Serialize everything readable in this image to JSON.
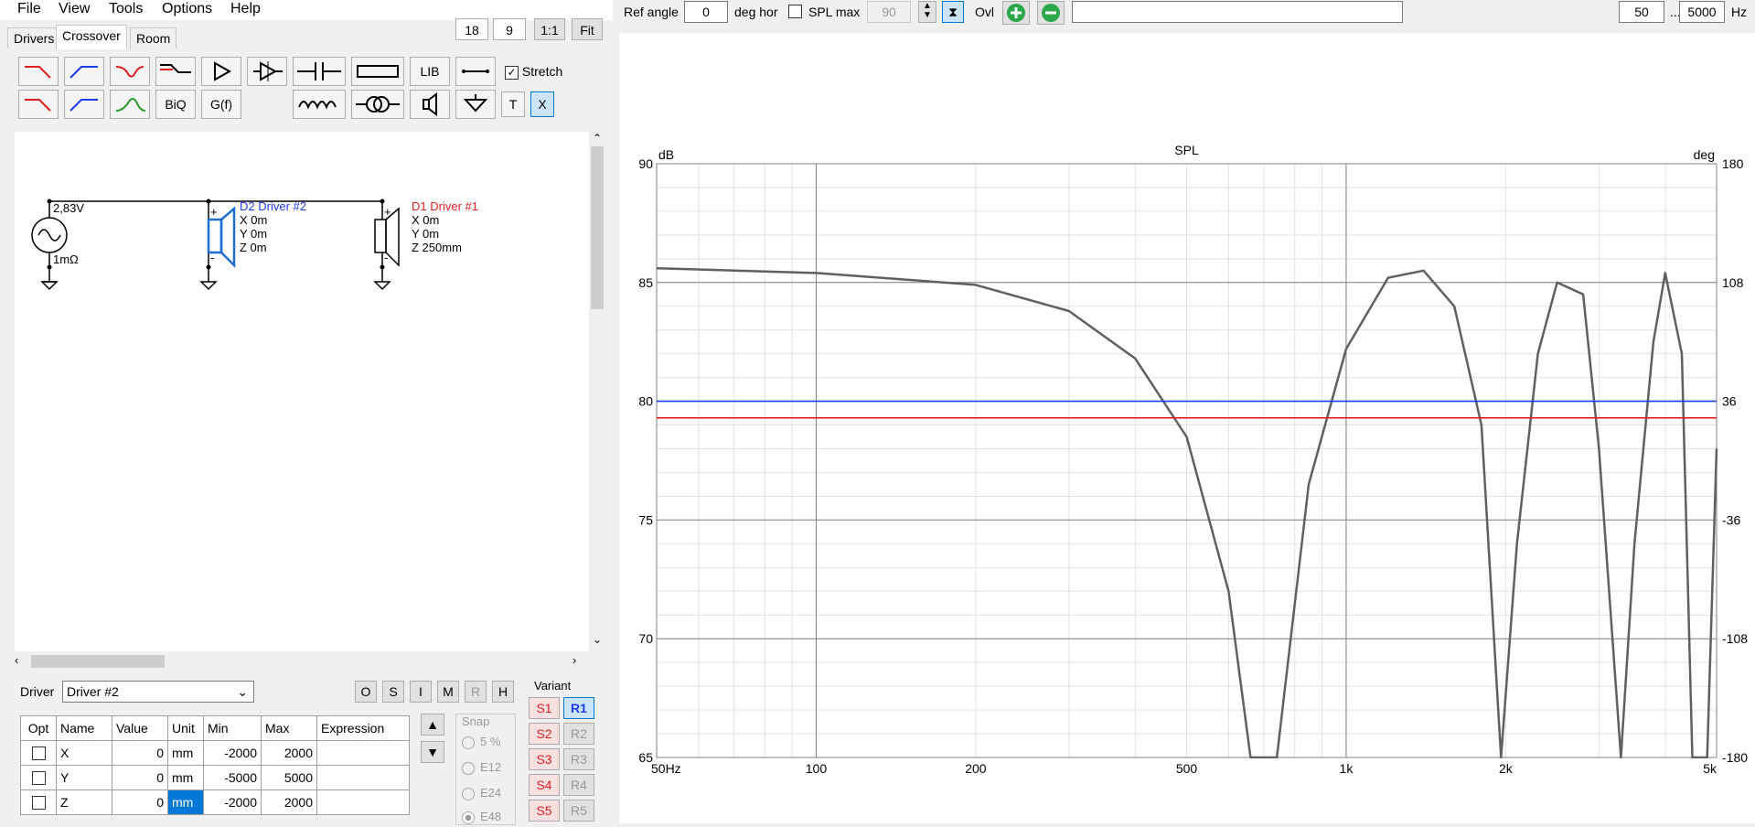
{
  "menu": [
    "File",
    "View",
    "Tools",
    "Options",
    "Help"
  ],
  "top_small": {
    "a": "18",
    "b": "9",
    "ratio": "1:1",
    "fit": "Fit"
  },
  "tabs": {
    "drivers": "Drivers",
    "crossover": "Crossover",
    "room": "Room"
  },
  "toolbar": {
    "biq": "BiQ",
    "gf": "G(f)",
    "lib": "LIB",
    "t": "T",
    "x": "X",
    "stretch_label": "Stretch",
    "stretch_checked": true
  },
  "schematic": {
    "source_voltage": "2,83V",
    "source_res": "1mΩ",
    "d2": {
      "name": "D2 Driver #2",
      "x": "X 0m",
      "y": "Y 0m",
      "z": "Z 0m",
      "color": "#1e3cf0"
    },
    "d1": {
      "name": "D1 Driver #1",
      "x": "X 0m",
      "y": "Y 0m",
      "z": "Z 250mm",
      "color": "#e02020"
    }
  },
  "driver_row": {
    "label": "Driver",
    "value": "Driver #2",
    "buttons": [
      "O",
      "S",
      "I",
      "M",
      "R",
      "H"
    ]
  },
  "table": {
    "headers": [
      "Opt",
      "Name",
      "Value",
      "Unit",
      "Min",
      "Max",
      "Expression"
    ],
    "rows": [
      {
        "name": "X",
        "value": "0",
        "unit": "mm",
        "min": "-2000",
        "max": "2000"
      },
      {
        "name": "Y",
        "value": "0",
        "unit": "mm",
        "min": "-5000",
        "max": "5000"
      },
      {
        "name": "Z",
        "value": "0",
        "unit": "mm",
        "min": "-2000",
        "max": "2000"
      }
    ]
  },
  "snap": {
    "label": "Snap",
    "options": [
      "5 %",
      "E12",
      "E24",
      "E48"
    ]
  },
  "variant": {
    "label": "Variant",
    "s": [
      "S1",
      "S2",
      "S3",
      "S4",
      "S5"
    ],
    "r": [
      "R1",
      "R2",
      "R3",
      "R4",
      "R5"
    ]
  },
  "graph_toolbar": {
    "ref_angle_label": "Ref angle",
    "ref_angle": "0",
    "deg_hor": "deg hor",
    "spl_max_label": "SPL max",
    "spl_max": "90",
    "ovl": "Ovl",
    "f_min": "50",
    "dots": "...",
    "f_max": "5000",
    "hz": "Hz"
  },
  "chart_data": {
    "type": "line",
    "title": "SPL",
    "xlabel": "",
    "ylabel": "dB",
    "y2label": "deg",
    "x_scale": "log",
    "xlim": [
      50,
      5000
    ],
    "ylim": [
      65,
      90
    ],
    "y2lim": [
      -180,
      180
    ],
    "x_ticks": [
      "50Hz",
      "100",
      "200",
      "500",
      "1k",
      "2k",
      "5k"
    ],
    "y_ticks": [
      "90",
      "85",
      "80",
      "75",
      "70",
      "65"
    ],
    "y2_ticks": [
      "180",
      "108",
      "36",
      "-36",
      "-108",
      "-180"
    ],
    "series": [
      {
        "color": "#606060",
        "x": [
          50,
          100,
          200,
          300,
          400,
          500,
          600,
          660,
          740,
          850,
          1000,
          1200,
          1400,
          1600,
          1800,
          1960,
          2100,
          2300,
          2500,
          2800,
          3000,
          3300,
          3500,
          3800,
          4000,
          4300,
          4500,
          4800,
          5000
        ],
        "y": [
          85.6,
          85.4,
          84.9,
          83.8,
          81.8,
          78.5,
          72.0,
          65.0,
          65.0,
          76.5,
          82.2,
          85.2,
          85.5,
          84.0,
          79.0,
          65.0,
          74.0,
          82.0,
          85.0,
          84.5,
          78.0,
          65.0,
          74.0,
          82.5,
          85.4,
          82.0,
          65.0,
          65.0,
          78.0
        ]
      },
      {
        "color": "#1e3cf0",
        "x": [
          50,
          5000
        ],
        "y": [
          80.0,
          80.0
        ]
      },
      {
        "color": "#e02020",
        "x": [
          50,
          5000
        ],
        "y": [
          79.3,
          79.3
        ]
      }
    ]
  }
}
